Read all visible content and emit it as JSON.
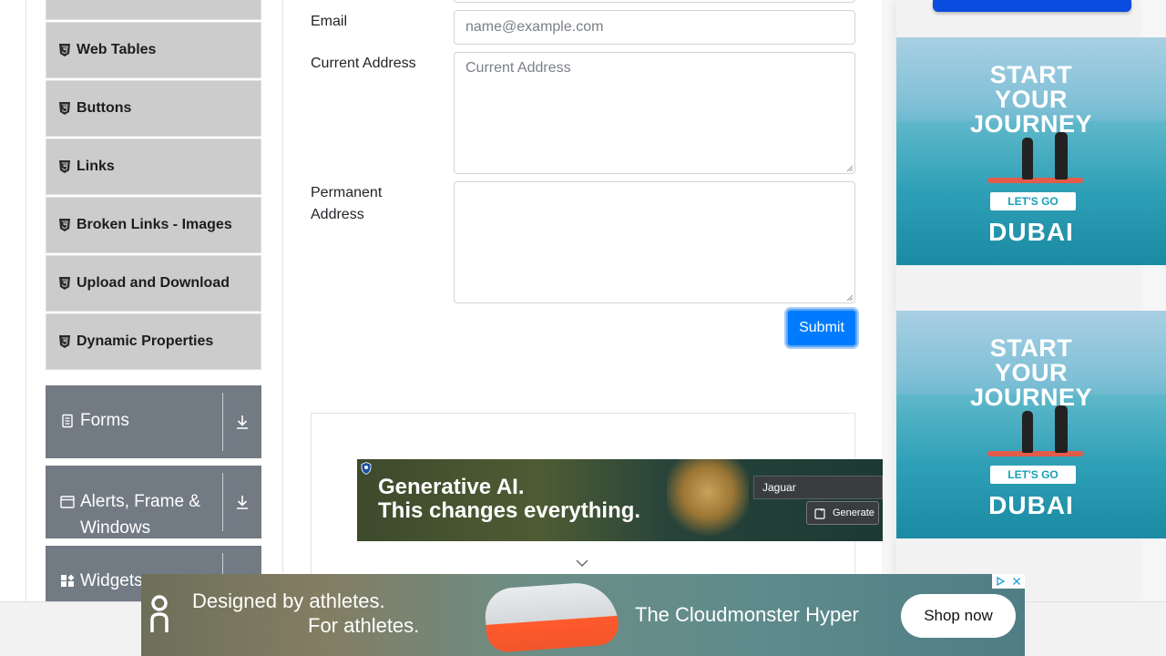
{
  "sidebar": {
    "elements_items": [
      {
        "label": "Web Tables"
      },
      {
        "label": "Buttons"
      },
      {
        "label": "Links"
      },
      {
        "label": "Broken Links - Images"
      },
      {
        "label": "Upload and Download"
      },
      {
        "label": "Dynamic Properties"
      }
    ],
    "groups": [
      {
        "label": "Forms"
      },
      {
        "label": "Alerts, Frame & Windows"
      },
      {
        "label": "Widgets"
      }
    ]
  },
  "form": {
    "email": {
      "label": "Email",
      "value": "",
      "placeholder": "name@example.com"
    },
    "current_address": {
      "label": "Current Address",
      "value": "",
      "placeholder": "Current Address"
    },
    "permanent_address": {
      "label": "Permanent Address",
      "value": "",
      "placeholder": ""
    },
    "submit_label": "Submit"
  },
  "ads": {
    "dubai": {
      "headline_1": "START",
      "headline_2": "YOUR",
      "headline_3": "JOURNEY",
      "cta": "LET'S GO",
      "brand": "DUBAI"
    },
    "genai": {
      "line_1": "Generative AI.",
      "line_2": "This changes everything.",
      "field_value": "Jaguar",
      "button": "Generate"
    },
    "on_running": {
      "line_1": "Designed by athletes.",
      "line_2": "For athletes.",
      "product": "The Cloudmonster Hyper",
      "cta": "Shop now"
    }
  },
  "colors": {
    "primary": "#007bff",
    "sidebar_group": "#727a84",
    "sidebar_item": "#cccccc"
  }
}
